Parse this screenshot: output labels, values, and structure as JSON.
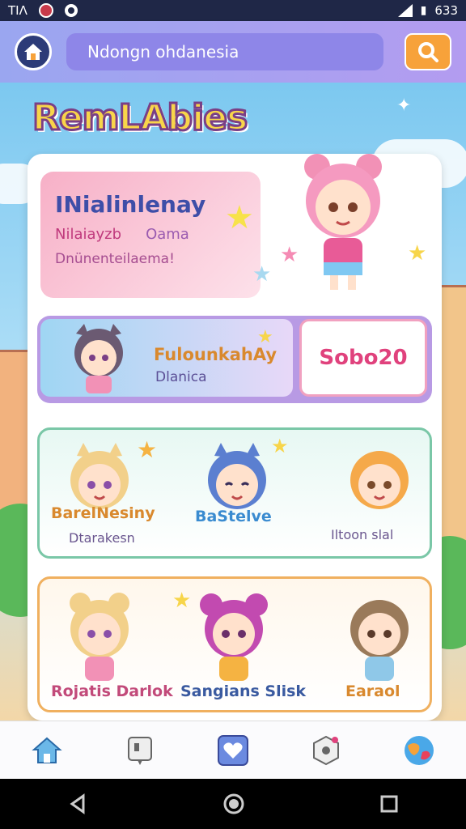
{
  "status_bar": {
    "left_text": "TIΛ",
    "time": "633"
  },
  "header": {
    "search_value": "Ndongn ohdanesia"
  },
  "title": "RemLAbies",
  "hero": {
    "title": "INialinlenay",
    "sub_left": "Nilaiayzb",
    "sub_right": "Oama",
    "foot": "Dnünenteilaema!"
  },
  "row2": {
    "title": "FulounkahAy",
    "subtitle": "Dlanica",
    "badge": "Sobo20"
  },
  "row3": {
    "items": [
      {
        "label": "BarelNesiny",
        "sub": "Dtarakesn"
      },
      {
        "label": "BaStelve",
        "sub": ""
      },
      {
        "label": "",
        "sub": "Iltoon slal"
      }
    ]
  },
  "row4": {
    "items": [
      {
        "label": "Rojatis Darlok"
      },
      {
        "label": "Sangians Slisk"
      },
      {
        "label": "Earaol"
      }
    ]
  },
  "colors": {
    "accent": "#f7a23a",
    "header": "#9aa6f0",
    "brand": "#7a3f86"
  },
  "nav": {
    "items": [
      {
        "name": "home-icon"
      },
      {
        "name": "stamp-icon"
      },
      {
        "name": "heart-icon"
      },
      {
        "name": "hex-settings-icon"
      },
      {
        "name": "globe-icon"
      }
    ]
  }
}
